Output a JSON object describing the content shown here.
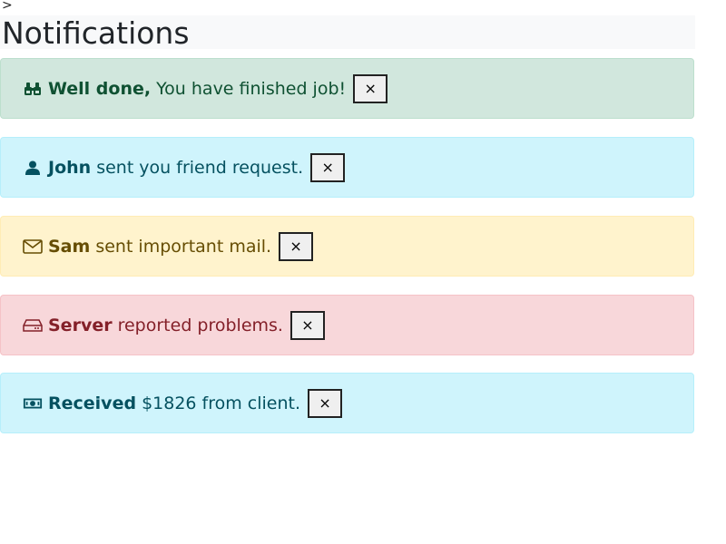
{
  "stray_char": ">",
  "page_title": "Notifications",
  "close_label": "×",
  "notifications": [
    {
      "type": "success",
      "icon": "binoculars-icon",
      "strong": "Well done,",
      "text": "You have finished job!"
    },
    {
      "type": "info",
      "icon": "person-icon",
      "strong": "John",
      "text": "sent you friend request."
    },
    {
      "type": "warning",
      "icon": "envelope-icon",
      "strong": "Sam",
      "text": "sent important mail."
    },
    {
      "type": "danger",
      "icon": "hdd-icon",
      "strong": "Server",
      "text": "reported problems."
    },
    {
      "type": "info",
      "icon": "cash-icon",
      "strong": "Received",
      "text": "$1826 from client."
    }
  ],
  "colors": {
    "success_bg": "#d1e7dd",
    "info_bg": "#cff4fc",
    "warning_bg": "#fff3cd",
    "danger_bg": "#f8d7da"
  }
}
